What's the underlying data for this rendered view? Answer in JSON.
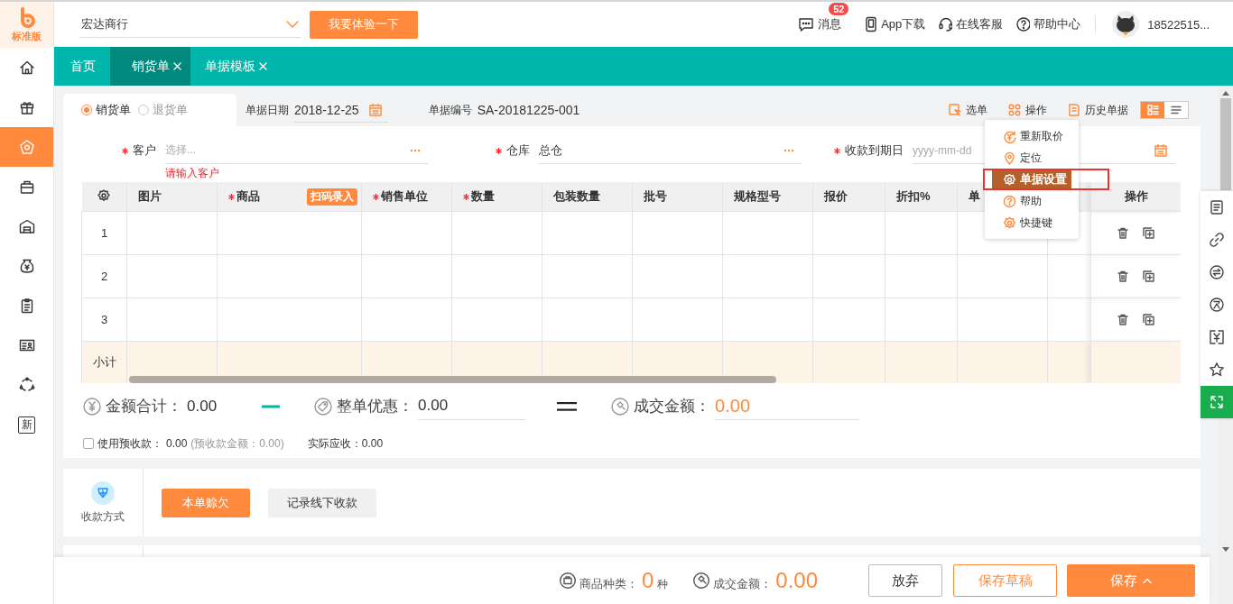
{
  "logo": {
    "edition": "标准版"
  },
  "sidebar": {
    "items": [
      {
        "kind": "home",
        "selected": false
      },
      {
        "kind": "gift",
        "selected": false
      },
      {
        "kind": "sale",
        "selected": true
      },
      {
        "kind": "bag",
        "selected": false
      },
      {
        "kind": "warehouse",
        "selected": false
      },
      {
        "kind": "money",
        "selected": false
      },
      {
        "kind": "clipboard",
        "selected": false
      },
      {
        "kind": "card",
        "selected": false
      },
      {
        "kind": "cycle",
        "selected": false
      },
      {
        "kind": "new",
        "text": "新",
        "selected": false
      }
    ]
  },
  "header": {
    "company": "宏达商行",
    "trial_button": "我要体验一下",
    "messages": {
      "label": "消息",
      "badge": "52"
    },
    "links": [
      {
        "kind": "phone",
        "label": "App下载"
      },
      {
        "kind": "headset",
        "label": "在线客服"
      },
      {
        "kind": "help",
        "label": "帮助中心"
      }
    ],
    "user": "18522515..."
  },
  "tabs": [
    {
      "label": "首页",
      "selected": false,
      "closable": false
    },
    {
      "label": "销货单",
      "selected": true,
      "closable": true
    },
    {
      "label": "单据模板",
      "selected": false,
      "closable": true
    }
  ],
  "doc_type": [
    {
      "label": "销货单",
      "selected": true
    },
    {
      "label": "退货单",
      "selected": false
    }
  ],
  "doc_date": {
    "label": "单据日期",
    "value": "2018-12-25"
  },
  "doc_number": {
    "label": "单据编号",
    "value": "SA-20181225-001"
  },
  "toolbar": [
    {
      "kind": "select",
      "label": "选单"
    },
    {
      "kind": "operate",
      "label": "操作"
    },
    {
      "kind": "history",
      "label": "历史单据"
    }
  ],
  "view_toggle": [
    {
      "kind": "card",
      "selected": true
    },
    {
      "kind": "list",
      "selected": false
    }
  ],
  "fields": [
    {
      "kind": "picker",
      "label": "客户",
      "required": true,
      "placeholder": "选择...",
      "error": "请输入客户"
    },
    {
      "kind": "picker",
      "label": "仓库",
      "required": true,
      "value": "总仓"
    },
    {
      "kind": "date",
      "label": "收款到期日",
      "required": true,
      "placeholder": "yyyy-mm-dd"
    }
  ],
  "table": {
    "columns": [
      {
        "label": "图片",
        "required": false
      },
      {
        "label": "商品",
        "required": true,
        "tag": "扫码录入"
      },
      {
        "label": "销售单位",
        "required": true
      },
      {
        "label": "数量",
        "required": true
      },
      {
        "label": "包装数量",
        "required": false
      },
      {
        "label": "批号",
        "required": false
      },
      {
        "label": "规格型号",
        "required": false
      },
      {
        "label": "报价",
        "required": false
      },
      {
        "label": "折扣%",
        "required": false
      },
      {
        "label": "单",
        "required": false
      },
      {
        "required": false
      }
    ],
    "action_column": "操作",
    "rows": [
      {
        "index": "1"
      },
      {
        "index": "2"
      },
      {
        "index": "3"
      }
    ],
    "subtotal_label": "小计"
  },
  "totals": {
    "amount": {
      "label": "金额合计：",
      "value": "0.00"
    },
    "discount": {
      "label": "整单优惠：",
      "value": "0.00"
    },
    "deal": {
      "label": "成交金额：",
      "value": "0.00"
    }
  },
  "prepay": {
    "checked": false,
    "label": "使用预收款：",
    "value": "0.00",
    "note": "(预收款金额：0.00)"
  },
  "actual_receivable": "实际应收：0.00",
  "payment": {
    "label": "收款方式",
    "options": [
      {
        "label": "本单赊欠",
        "selected": true
      },
      {
        "label": "记录线下收款",
        "selected": false
      }
    ]
  },
  "menu": {
    "items": [
      {
        "kind": "reprice",
        "label": "重新取价",
        "selected": false
      },
      {
        "kind": "locate",
        "label": "定位",
        "selected": false
      },
      {
        "kind": "settings",
        "label": "单据设置",
        "selected": true
      },
      {
        "kind": "help",
        "label": "帮助",
        "selected": false
      },
      {
        "kind": "shortcut",
        "label": "快捷键",
        "selected": false
      }
    ]
  },
  "side_tools": [
    {
      "kind": "note",
      "active": false
    },
    {
      "kind": "link",
      "active": false
    },
    {
      "kind": "exchange",
      "active": false
    },
    {
      "kind": "owe",
      "active": false
    },
    {
      "kind": "yen",
      "active": false
    },
    {
      "kind": "star",
      "active": false
    },
    {
      "kind": "expand",
      "active": true
    }
  ],
  "footer": {
    "kinds_label": "商品种类：",
    "kinds_value": "0",
    "kinds_unit": "种",
    "amount_label": "成交金额：",
    "amount_value": "0.00",
    "buttons": [
      {
        "kind": "secondary",
        "label": "放弃"
      },
      {
        "kind": "outline",
        "label": "保存草稿"
      },
      {
        "kind": "primary",
        "label": "保存"
      }
    ]
  }
}
